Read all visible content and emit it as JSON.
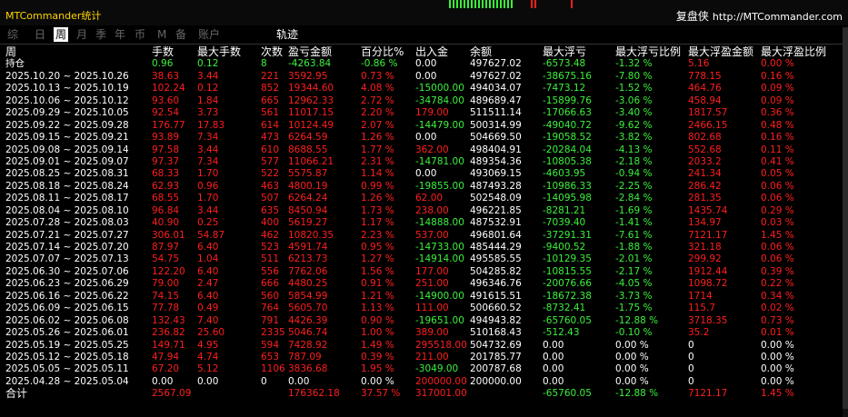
{
  "app_title": "MTCommander统计",
  "brand": {
    "cn": "复盘侠",
    "url": "http://MTCommander.com"
  },
  "tabs": [
    {
      "label": "综",
      "active": false
    },
    {
      "label": "日",
      "active": false
    },
    {
      "label": "周",
      "active": true
    },
    {
      "label": "月",
      "active": false
    },
    {
      "label": "季",
      "active": false
    },
    {
      "label": "年",
      "active": false
    },
    {
      "label": "币",
      "active": false
    },
    {
      "label": "M",
      "active": false
    },
    {
      "label": "备",
      "active": false
    },
    {
      "label": "账户",
      "active": false
    },
    {
      "label": "轨迹",
      "active": false
    }
  ],
  "colors": {
    "positive": "#3cf03c",
    "negative": "#ff1e1e",
    "neutral": "#ffffff",
    "title": "#ffd400",
    "active_tab_bg": "#ffffff"
  },
  "headers": [
    "周",
    "手数",
    "最大手数",
    "次数",
    "盈亏金额",
    "百分比%",
    "出入金",
    "余额",
    "最大浮亏",
    "最大浮亏比例",
    "最大浮盈金额",
    "最大浮盈比例"
  ],
  "rows": [
    {
      "c": [
        "持仓",
        "0.96",
        "0.12",
        "8",
        "-4263.84",
        "-0.86 %",
        "0.00",
        "497627.02",
        "-6573.48",
        "-1.32 %",
        "5.16",
        "0.00 %"
      ],
      "s": [
        "w",
        "g",
        "g",
        "g",
        "g",
        "g",
        "w",
        "w",
        "g",
        "g",
        "r",
        "r"
      ]
    },
    {
      "c": [
        "2025.10.20 ~ 2025.10.26",
        "38.63",
        "3.44",
        "221",
        "3592.95",
        "0.73 %",
        "0.00",
        "497627.02",
        "-38675.16",
        "-7.80 %",
        "778.15",
        "0.16 %"
      ],
      "s": [
        "w",
        "r",
        "r",
        "r",
        "r",
        "r",
        "w",
        "w",
        "g",
        "g",
        "r",
        "r"
      ]
    },
    {
      "c": [
        "2025.10.13 ~ 2025.10.19",
        "102.24",
        "0.12",
        "852",
        "19344.60",
        "4.08 %",
        "-15000.00",
        "494034.07",
        "-7473.12",
        "-1.52 %",
        "464.76",
        "0.09 %"
      ],
      "s": [
        "w",
        "r",
        "r",
        "r",
        "r",
        "r",
        "g",
        "w",
        "g",
        "g",
        "r",
        "r"
      ]
    },
    {
      "c": [
        "2025.10.06 ~ 2025.10.12",
        "93.60",
        "1.84",
        "665",
        "12962.33",
        "2.72 %",
        "-34784.00",
        "489689.47",
        "-15899.76",
        "-3.06 %",
        "458.94",
        "0.09 %"
      ],
      "s": [
        "w",
        "r",
        "r",
        "r",
        "r",
        "r",
        "g",
        "w",
        "g",
        "g",
        "r",
        "r"
      ]
    },
    {
      "c": [
        "2025.09.29 ~ 2025.10.05",
        "92.54",
        "3.73",
        "561",
        "11017.15",
        "2.20 %",
        "179.00",
        "511511.14",
        "-17066.63",
        "-3.40 %",
        "1817.57",
        "0.36 %"
      ],
      "s": [
        "w",
        "r",
        "r",
        "r",
        "r",
        "r",
        "r",
        "w",
        "g",
        "g",
        "r",
        "r"
      ]
    },
    {
      "c": [
        "2025.09.22 ~ 2025.09.28",
        "176.77",
        "17.83",
        "614",
        "10124.49",
        "2.07 %",
        "-14479.00",
        "500314.99",
        "-49040.72",
        "-9.62 %",
        "2466.15",
        "0.48 %"
      ],
      "s": [
        "w",
        "r",
        "r",
        "r",
        "r",
        "r",
        "g",
        "w",
        "g",
        "g",
        "r",
        "r"
      ]
    },
    {
      "c": [
        "2025.09.15 ~ 2025.09.21",
        "93.89",
        "7.34",
        "473",
        "6264.59",
        "1.26 %",
        "0.00",
        "504669.50",
        "-19058.52",
        "-3.82 %",
        "802.68",
        "0.16 %"
      ],
      "s": [
        "w",
        "r",
        "r",
        "r",
        "r",
        "r",
        "w",
        "w",
        "g",
        "g",
        "r",
        "r"
      ]
    },
    {
      "c": [
        "2025.09.08 ~ 2025.09.14",
        "97.58",
        "3.44",
        "610",
        "8688.55",
        "1.77 %",
        "362.00",
        "498404.91",
        "-20284.04",
        "-4.13 %",
        "552.68",
        "0.11 %"
      ],
      "s": [
        "w",
        "r",
        "r",
        "r",
        "r",
        "r",
        "r",
        "w",
        "g",
        "g",
        "r",
        "r"
      ]
    },
    {
      "c": [
        "2025.09.01 ~ 2025.09.07",
        "97.37",
        "7.34",
        "577",
        "11066.21",
        "2.31 %",
        "-14781.00",
        "489354.36",
        "-10805.38",
        "-2.18 %",
        "2033.2",
        "0.41 %"
      ],
      "s": [
        "w",
        "r",
        "r",
        "r",
        "r",
        "r",
        "g",
        "w",
        "g",
        "g",
        "r",
        "r"
      ]
    },
    {
      "c": [
        "2025.08.25 ~ 2025.08.31",
        "68.33",
        "1.70",
        "522",
        "5575.87",
        "1.14 %",
        "0.00",
        "493069.15",
        "-4603.95",
        "-0.94 %",
        "241.34",
        "0.05 %"
      ],
      "s": [
        "w",
        "r",
        "r",
        "r",
        "r",
        "r",
        "w",
        "w",
        "g",
        "g",
        "r",
        "r"
      ]
    },
    {
      "c": [
        "2025.08.18 ~ 2025.08.24",
        "62.93",
        "0.96",
        "463",
        "4800.19",
        "0.99 %",
        "-19855.00",
        "487493.28",
        "-10986.33",
        "-2.25 %",
        "286.42",
        "0.06 %"
      ],
      "s": [
        "w",
        "r",
        "r",
        "r",
        "r",
        "r",
        "g",
        "w",
        "g",
        "g",
        "r",
        "r"
      ]
    },
    {
      "c": [
        "2025.08.11 ~ 2025.08.17",
        "68.55",
        "1.70",
        "507",
        "6264.24",
        "1.26 %",
        "62.00",
        "502548.09",
        "-14095.98",
        "-2.84 %",
        "281.35",
        "0.06 %"
      ],
      "s": [
        "w",
        "r",
        "r",
        "r",
        "r",
        "r",
        "r",
        "w",
        "g",
        "g",
        "r",
        "r"
      ]
    },
    {
      "c": [
        "2025.08.04 ~ 2025.08.10",
        "96.84",
        "3.44",
        "635",
        "8450.94",
        "1.73 %",
        "238.00",
        "496221.85",
        "-8281.21",
        "-1.69 %",
        "1435.74",
        "0.29 %"
      ],
      "s": [
        "w",
        "r",
        "r",
        "r",
        "r",
        "r",
        "r",
        "w",
        "g",
        "g",
        "r",
        "r"
      ]
    },
    {
      "c": [
        "2025.07.28 ~ 2025.08.03",
        "40.90",
        "0.25",
        "400",
        "5619.27",
        "1.17 %",
        "-14888.00",
        "487532.91",
        "-7039.40",
        "-1.41 %",
        "134.97",
        "0.03 %"
      ],
      "s": [
        "w",
        "r",
        "r",
        "r",
        "r",
        "r",
        "g",
        "w",
        "g",
        "g",
        "r",
        "r"
      ]
    },
    {
      "c": [
        "2025.07.21 ~ 2025.07.27",
        "306.01",
        "54.87",
        "462",
        "10820.35",
        "2.23 %",
        "537.00",
        "496801.64",
        "-37291.31",
        "-7.61 %",
        "7121.17",
        "1.45 %"
      ],
      "s": [
        "w",
        "r",
        "r",
        "r",
        "r",
        "r",
        "r",
        "w",
        "g",
        "g",
        "r",
        "r"
      ]
    },
    {
      "c": [
        "2025.07.14 ~ 2025.07.20",
        "87.97",
        "6.40",
        "523",
        "4591.74",
        "0.95 %",
        "-14733.00",
        "485444.29",
        "-9400.52",
        "-1.88 %",
        "321.18",
        "0.06 %"
      ],
      "s": [
        "w",
        "r",
        "r",
        "r",
        "r",
        "r",
        "g",
        "w",
        "g",
        "g",
        "r",
        "r"
      ]
    },
    {
      "c": [
        "2025.07.07 ~ 2025.07.13",
        "54.75",
        "1.04",
        "511",
        "6213.73",
        "1.27 %",
        "-14914.00",
        "495585.55",
        "-10129.35",
        "-2.01 %",
        "299.92",
        "0.06 %"
      ],
      "s": [
        "w",
        "r",
        "r",
        "r",
        "r",
        "r",
        "g",
        "w",
        "g",
        "g",
        "r",
        "r"
      ]
    },
    {
      "c": [
        "2025.06.30 ~ 2025.07.06",
        "122.20",
        "6.40",
        "556",
        "7762.06",
        "1.56 %",
        "177.00",
        "504285.82",
        "-10815.55",
        "-2.17 %",
        "1912.44",
        "0.39 %"
      ],
      "s": [
        "w",
        "r",
        "r",
        "r",
        "r",
        "r",
        "r",
        "w",
        "g",
        "g",
        "r",
        "r"
      ]
    },
    {
      "c": [
        "2025.06.23 ~ 2025.06.29",
        "79.00",
        "2.47",
        "666",
        "4480.25",
        "0.91 %",
        "251.00",
        "496346.76",
        "-20076.66",
        "-4.05 %",
        "1098.72",
        "0.22 %"
      ],
      "s": [
        "w",
        "r",
        "r",
        "r",
        "r",
        "r",
        "r",
        "w",
        "g",
        "g",
        "r",
        "r"
      ]
    },
    {
      "c": [
        "2025.06.16 ~ 2025.06.22",
        "74.15",
        "6.40",
        "560",
        "5854.99",
        "1.21 %",
        "-14900.00",
        "491615.51",
        "-18672.38",
        "-3.73 %",
        "1714",
        "0.34 %"
      ],
      "s": [
        "w",
        "r",
        "r",
        "r",
        "r",
        "r",
        "g",
        "w",
        "g",
        "g",
        "r",
        "r"
      ]
    },
    {
      "c": [
        "2025.06.09 ~ 2025.06.15",
        "77.78",
        "0.49",
        "764",
        "5605.70",
        "1.13 %",
        "111.00",
        "500660.52",
        "-8732.41",
        "-1.75 %",
        "115.7",
        "0.02 %"
      ],
      "s": [
        "w",
        "r",
        "r",
        "r",
        "r",
        "r",
        "r",
        "w",
        "g",
        "g",
        "r",
        "r"
      ]
    },
    {
      "c": [
        "2025.06.02 ~ 2025.06.08",
        "132.43",
        "7.40",
        "791",
        "4426.39",
        "0.90 %",
        "-19651.00",
        "494943.82",
        "-65760.05",
        "-12.88 %",
        "3718.35",
        "0.73 %"
      ],
      "s": [
        "w",
        "r",
        "r",
        "r",
        "r",
        "r",
        "g",
        "w",
        "g",
        "g",
        "r",
        "r"
      ]
    },
    {
      "c": [
        "2025.05.26 ~ 2025.06.01",
        "236.82",
        "25.60",
        "2335",
        "5046.74",
        "1.00 %",
        "389.00",
        "510168.43",
        "-512.43",
        "-0.10 %",
        "35.2",
        "0.01 %"
      ],
      "s": [
        "w",
        "r",
        "r",
        "r",
        "r",
        "r",
        "r",
        "w",
        "g",
        "g",
        "r",
        "r"
      ]
    },
    {
      "c": [
        "2025.05.19 ~ 2025.05.25",
        "149.71",
        "4.95",
        "594",
        "7428.92",
        "1.49 %",
        "295518.00",
        "504732.69",
        "0.00",
        "0.00 %",
        "0",
        "0.00 %"
      ],
      "s": [
        "w",
        "r",
        "r",
        "r",
        "r",
        "r",
        "r",
        "w",
        "w",
        "w",
        "w",
        "w"
      ]
    },
    {
      "c": [
        "2025.05.12 ~ 2025.05.18",
        "47.94",
        "4.74",
        "653",
        "787.09",
        "0.39 %",
        "211.00",
        "201785.77",
        "0.00",
        "0.00 %",
        "0",
        "0.00 %"
      ],
      "s": [
        "w",
        "r",
        "r",
        "r",
        "r",
        "r",
        "r",
        "w",
        "w",
        "w",
        "w",
        "w"
      ]
    },
    {
      "c": [
        "2025.05.05 ~ 2025.05.11",
        "67.20",
        "5.12",
        "1106",
        "3836.68",
        "1.95 %",
        "-3049.00",
        "200787.68",
        "0.00",
        "0.00 %",
        "0",
        "0.00 %"
      ],
      "s": [
        "w",
        "r",
        "r",
        "r",
        "r",
        "r",
        "g",
        "w",
        "w",
        "w",
        "w",
        "w"
      ]
    },
    {
      "c": [
        "2025.04.28 ~ 2025.05.04",
        "0.00",
        "0.00",
        "0",
        "0.00",
        "0.00 %",
        "200000.00",
        "200000.00",
        "0.00",
        "0.00 %",
        "0",
        "0.00 %"
      ],
      "s": [
        "w",
        "w",
        "w",
        "w",
        "w",
        "w",
        "r",
        "w",
        "w",
        "w",
        "w",
        "w"
      ]
    }
  ],
  "total": {
    "c": [
      "合计",
      "2567.09",
      "",
      "",
      "176362.18",
      "37.57 %",
      "317001.00",
      "",
      "-65760.05",
      "-12.88 %",
      "7121.17",
      "1.45 %"
    ],
    "s": [
      "w",
      "r",
      "w",
      "w",
      "r",
      "r",
      "r",
      "w",
      "g",
      "g",
      "r",
      "r"
    ]
  }
}
